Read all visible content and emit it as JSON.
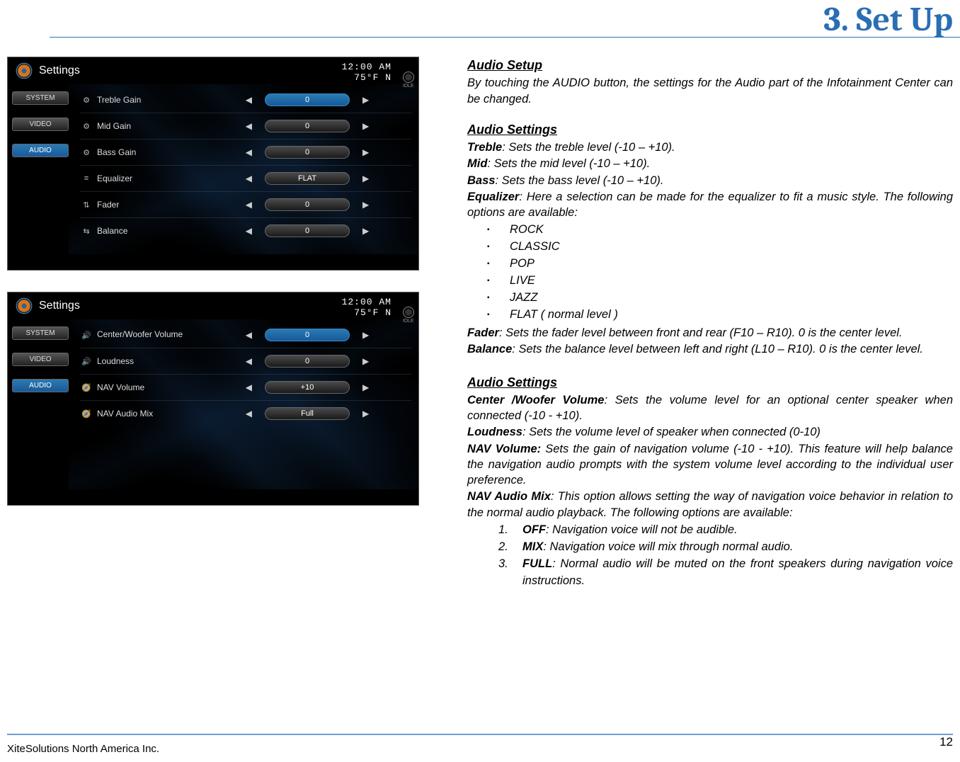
{
  "page": {
    "chapter_title": "3. Set Up",
    "footer_left": "XiteSolutions North America Inc.",
    "page_number": "12"
  },
  "screenshot1": {
    "title": "Settings",
    "clock": "12:00 AM",
    "temp": "75°F  N",
    "idle": "IDLE",
    "tabs": [
      "SYSTEM",
      "VIDEO",
      "AUDIO"
    ],
    "rows": [
      {
        "icon": "sliders",
        "label": "Treble Gain",
        "value": "0",
        "active": true
      },
      {
        "icon": "sliders",
        "label": "Mid Gain",
        "value": "0",
        "active": false
      },
      {
        "icon": "sliders",
        "label": "Bass Gain",
        "value": "0",
        "active": false
      },
      {
        "icon": "equalizer",
        "label": "Equalizer",
        "value": "FLAT",
        "active": false
      },
      {
        "icon": "fader",
        "label": "Fader",
        "value": "0",
        "active": false
      },
      {
        "icon": "balance",
        "label": "Balance",
        "value": "0",
        "active": false
      }
    ]
  },
  "screenshot2": {
    "title": "Settings",
    "clock": "12:00 AM",
    "temp": "75°F  N",
    "idle": "IDLE",
    "tabs": [
      "SYSTEM",
      "VIDEO",
      "AUDIO"
    ],
    "rows": [
      {
        "icon": "speaker",
        "label": "Center/Woofer Volume",
        "value": "0",
        "active": true,
        "twoLine": true
      },
      {
        "icon": "speaker",
        "label": "Loudness",
        "value": "0",
        "active": false
      },
      {
        "icon": "nav",
        "label": "NAV Volume",
        "value": "+10",
        "active": false
      },
      {
        "icon": "nav",
        "label": "NAV Audio Mix",
        "value": "Full",
        "active": false
      }
    ]
  },
  "text": {
    "audio_setup_h": "Audio Setup",
    "audio_setup_p": "By touching the AUDIO button, the settings for the Audio part of the Infotainment Center can be changed.",
    "audio_settings_h": "Audio Settings",
    "treble_b": "Treble",
    "treble_r": ": Sets the treble level (-10 – +10).",
    "mid_b": "Mid",
    "mid_r": ": Sets the mid level (-10 – +10).",
    "bass_b": "Bass",
    "bass_r": ": Sets the bass level (-10 – +10).",
    "eq_b": "Equalizer",
    "eq_r": ": Here a selection can be made for the equalizer to fit a music style. The following options are available:",
    "eq_opts": [
      "ROCK",
      "CLASSIC",
      "POP",
      "LIVE",
      "JAZZ",
      "FLAT ( normal level )"
    ],
    "fader_b": "Fader",
    "fader_r": ": Sets the fader level between front and rear (F10 – R10). 0 is the center level.",
    "balance_b": "Balance",
    "balance_r": ": Sets the balance level between left and right (L10 – R10). 0 is the center level.",
    "audio_settings2_h": "Audio Settings",
    "cw_b": "Center /Woofer Volume",
    "cw_r": ": Sets the volume level for an optional center speaker when connected (-10 - +10).",
    "loud_b": "Loudness",
    "loud_r": ": Sets the volume level of speaker when connected (0-10)",
    "navvol_b": "NAV Volume:",
    "navvol_r": " Sets the gain of navigation volume (-10 - +10).  This feature will help balance the navigation audio prompts with the system volume level according to the individual user preference.",
    "navmix_b": "NAV Audio Mix",
    "navmix_r": ": This option allows setting the way of navigation voice behavior in relation to the normal audio playback. The following options are available:",
    "navmix_opts": [
      {
        "n": "1.",
        "b": "OFF",
        "r": ": Navigation voice will not be audible."
      },
      {
        "n": "2.",
        "b": "MIX",
        "r": ": Navigation voice will mix through normal audio."
      },
      {
        "n": "3.",
        "b": "FULL",
        "r": ": Normal audio will be muted on the front speakers during navigation voice instructions."
      }
    ]
  }
}
